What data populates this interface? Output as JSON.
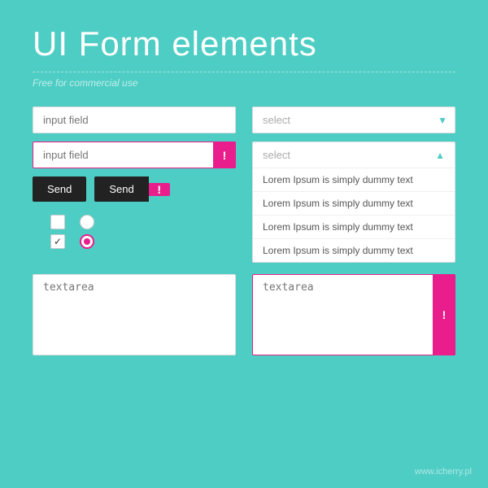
{
  "page": {
    "title": "UI Form elements",
    "divider": true,
    "subtitle": "Free for commercial use",
    "footer": "www.icherry.pl"
  },
  "inputs": {
    "normal_placeholder": "input field",
    "error_placeholder": "input field",
    "error_icon": "!"
  },
  "buttons": {
    "send_label": "Send",
    "send_error_label": "Send",
    "error_icon": "!"
  },
  "select": {
    "normal_label": "select",
    "open_label": "select",
    "options": [
      "Lorem Ipsum is simply dummy text",
      "Lorem Ipsum is simply dummy text",
      "Lorem Ipsum is simply dummy text",
      "Lorem Ipsum is simply dummy text"
    ]
  },
  "textarea": {
    "normal_placeholder": "textarea",
    "error_placeholder": "textarea",
    "error_icon": "!"
  }
}
